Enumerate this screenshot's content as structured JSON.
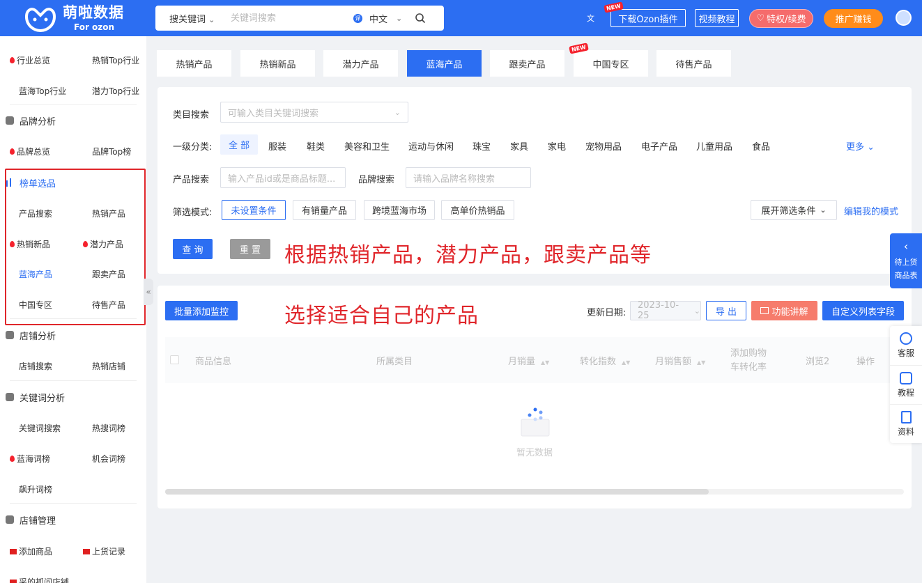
{
  "header": {
    "logo_title": "萌啦数据",
    "logo_sub": "For ozon",
    "search_type": "搜关键词",
    "search_placeholder": "关键词搜索",
    "language": "中文",
    "lang_badge": "译",
    "new_badge": "NEW",
    "download_plugin": "下载Ozon插件",
    "video_tutorial": "视频教程",
    "privilege": "特权/续费",
    "promote": "推广赚钱"
  },
  "sidebar": {
    "industry_overview": "行业总览",
    "hot_top_industry": "热销Top行业",
    "blue_top_industry": "蓝海Top行业",
    "potential_top_industry": "潜力Top行业",
    "brand_analysis": "品牌分析",
    "brand_overview": "品牌总览",
    "brand_top": "品牌Top榜",
    "ranking_select": "榜单选品",
    "product_search": "产品搜索",
    "hot_products": "热销产品",
    "hot_new": "热销新品",
    "potential_products": "潜力产品",
    "blue_products": "蓝海产品",
    "follow_products": "跟卖产品",
    "china_zone": "中国专区",
    "pending_products": "待售产品",
    "store_analysis": "店铺分析",
    "store_search": "店铺搜索",
    "hot_stores": "热销店铺",
    "keyword_analysis": "关键词分析",
    "keyword_search": "关键词搜索",
    "hot_search_words": "热搜词榜",
    "blue_words": "蓝海词榜",
    "opportunity_words": "机会词榜",
    "rising_words": "飙升词榜",
    "store_management": "店铺管理",
    "add_product": "添加商品",
    "upload_record": "上货记录",
    "cut_off": "采的抓问店铺"
  },
  "tabs": [
    "热销产品",
    "热销新品",
    "潜力产品",
    "蓝海产品",
    "跟卖产品",
    "中国专区",
    "待售产品"
  ],
  "active_tab": "蓝海产品",
  "tab_new_badge": "NEW",
  "filters": {
    "category_search_label": "类目搜索",
    "category_search_placeholder": "可输入类目关键词搜索",
    "level1_label": "一级分类:",
    "categories": [
      "全 部",
      "服装",
      "鞋类",
      "美容和卫生",
      "运动与休闲",
      "珠宝",
      "家具",
      "家电",
      "宠物用品",
      "电子产品",
      "儿童用品",
      "食品"
    ],
    "more": "更多",
    "product_search_label": "产品搜索",
    "product_search_placeholder": "输入产品id或是商品标题...",
    "brand_search_label": "品牌搜索",
    "brand_search_placeholder": "请输入品牌名称搜索",
    "mode_label": "筛选模式:",
    "modes": [
      "未设置条件",
      "有销量产品",
      "跨境蓝海市场",
      "高单价热销品"
    ],
    "expand": "展开筛选条件",
    "edit_mode": "编辑我的模式",
    "query": "查 询",
    "reset": "重 置"
  },
  "annotations": {
    "line1": "根据热销产品，潜力产品，跟卖产品等",
    "line2": "选择适合自己的产品"
  },
  "table": {
    "batch_monitor": "批量添加监控",
    "update_date_label": "更新日期:",
    "update_date": "2023-10-25",
    "export": "导 出",
    "feature_explain": "功能讲解",
    "custom_columns": "自定义列表字段",
    "columns": [
      "商品信息",
      "所属类目",
      "月销量",
      "转化指数",
      "月销售额",
      "添加购物\n车转化率",
      "浏览2",
      "操作"
    ],
    "empty": "暂无数据"
  },
  "right_float": {
    "pending_upload": "待上货\n商品表",
    "service": "客服",
    "tutorial": "教程",
    "materials": "资料"
  },
  "colors": {
    "primary": "#2c6ef2",
    "annotation": "#e0262b",
    "privilege_pill": "#f56c6c",
    "promote_pill": "#ff8c1a",
    "feature_btn": "#f67c6c"
  }
}
